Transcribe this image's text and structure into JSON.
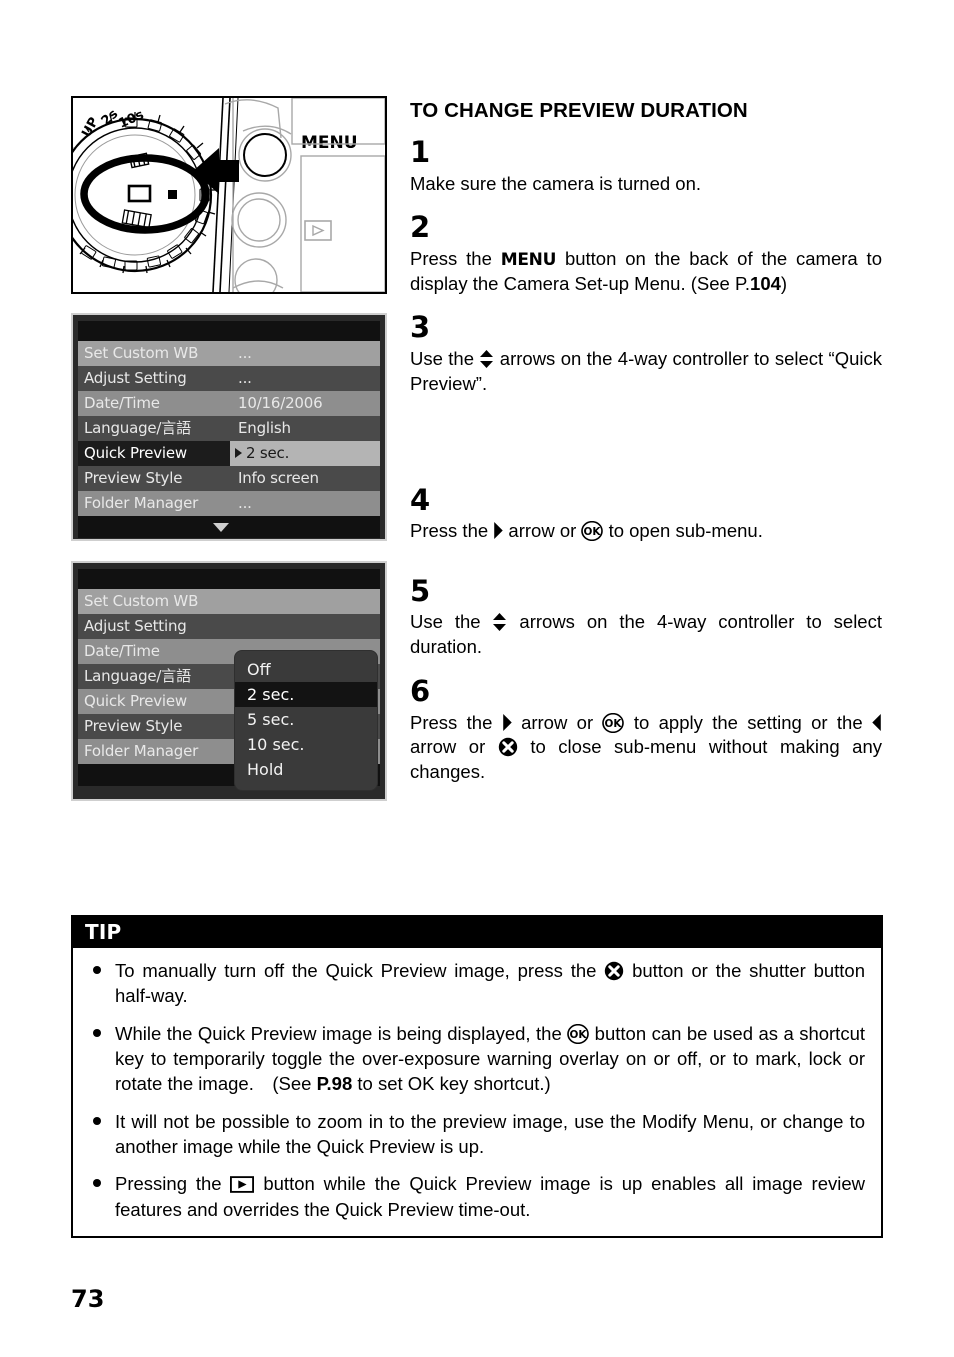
{
  "page": {
    "number": "73"
  },
  "figure_camera": {
    "menu_label": "MENU",
    "dial_labels": [
      "UP",
      "2s",
      "10s"
    ],
    "alt": "camera top dial set to single-frame mode with arrow pointing at MENU button"
  },
  "lcd_menu_1": {
    "rows": [
      {
        "label": "Set Custom WB",
        "value": "...",
        "shade": "light",
        "selected": false
      },
      {
        "label": "Adjust Setting",
        "value": "...",
        "shade": "dark",
        "selected": false
      },
      {
        "label": "Date/Time",
        "value": "10/16/2006",
        "shade": "mid",
        "selected": false
      },
      {
        "label": "Language/言語",
        "value": "English",
        "shade": "dark",
        "selected": false
      },
      {
        "label": "Quick Preview",
        "value": "2 sec.",
        "shade": "dark",
        "selected": true
      },
      {
        "label": "Preview Style",
        "value": "Info screen",
        "shade": "dark",
        "selected": false
      },
      {
        "label": "Folder Manager",
        "value": "...",
        "shade": "mid",
        "selected": false
      }
    ],
    "scroll_caret": "down-caret-icon"
  },
  "lcd_menu_2": {
    "rows": [
      {
        "label": "Set Custom WB",
        "shade": "light"
      },
      {
        "label": "Adjust Setting",
        "shade": "dark"
      },
      {
        "label": "Date/Time",
        "shade": "mid"
      },
      {
        "label": "Language/言語",
        "shade": "dark"
      },
      {
        "label": "Quick Preview",
        "shade": "mid"
      },
      {
        "label": "Preview Style",
        "shade": "dark"
      },
      {
        "label": "Folder Manager",
        "shade": "mid"
      }
    ],
    "submenu": {
      "items": [
        "Off",
        "2 sec.",
        "5 sec.",
        "10 sec.",
        "Hold"
      ],
      "selected": "2 sec."
    }
  },
  "instructions": {
    "title": "TO CHANGE PREVIEW DURATION",
    "steps": [
      {
        "number": "1",
        "text_a": "Make sure the camera is turned on."
      },
      {
        "number": "2",
        "text_a": "Press the ",
        "menu_word": "MENU",
        "text_b": " button on the back of the camera to display the Camera Set-up Menu. (See P.",
        "bold_ref": "104",
        "text_c": ")"
      },
      {
        "number": "3",
        "text_a": "Use the ",
        "icon_1": "up-down-arrows-icon",
        "text_b": " arrows on the 4-way controller to select “Quick Preview”."
      },
      {
        "number": "4",
        "text_a": "Press the ",
        "icon_1": "right-arrow-icon",
        "text_b": " arrow or ",
        "icon_2": "ok-button-icon",
        "text_c": " to open sub-menu."
      },
      {
        "number": "5",
        "text_a": "Use the ",
        "icon_1": "up-down-arrows-icon",
        "text_b": " arrows on the 4-way controller to select duration."
      },
      {
        "number": "6",
        "text_a": "Press the ",
        "icon_1": "right-arrow-icon",
        "text_b": " arrow or ",
        "icon_2": "ok-button-icon",
        "text_c": " to apply the setting or the ",
        "icon_3": "left-arrow-icon",
        "text_d": " arrow or ",
        "icon_4": "cancel-button-icon",
        "text_e": " to close sub-menu without making any changes."
      }
    ]
  },
  "tip": {
    "header": "TIP",
    "items": [
      {
        "text_a": "To manually turn off the Quick Preview image, press the ",
        "icon_1": "cancel-button-icon",
        "text_b": " button or the shutter button half-way."
      },
      {
        "text_a": "While the Quick Preview image is being displayed, the ",
        "icon_1": "ok-button-icon",
        "text_b": " button can be used as a shortcut key to temporarily toggle the over-exposure warning overlay on or off, or to mark, lock or rotate the image. (See ",
        "bold_ref": "P.98",
        "text_c": " to set OK key shortcut.)"
      },
      {
        "text_a": "It will not be possible to zoom in to the preview image, use the Modify Menu, or change to another image while the Quick Preview is up."
      },
      {
        "text_a": "Pressing the ",
        "icon_1": "playback-button-icon",
        "text_b": " button while the Quick Preview image is up enables all image review features and overrides the Quick Preview time-out."
      }
    ]
  },
  "colors": {
    "ink": "#000000",
    "paper": "#ffffff",
    "lcd_bg": "#2a2a2a",
    "lcd_row_light": "#a0a0a0",
    "lcd_row_mid": "#8e8e8e",
    "lcd_row_dark": "#4a4a4a",
    "lcd_selected_label": "#1c1c1c",
    "lcd_selected_value": "#b4b4b4",
    "submenu_bg": "#3a3a3a",
    "submenu_selected": "#131313"
  }
}
